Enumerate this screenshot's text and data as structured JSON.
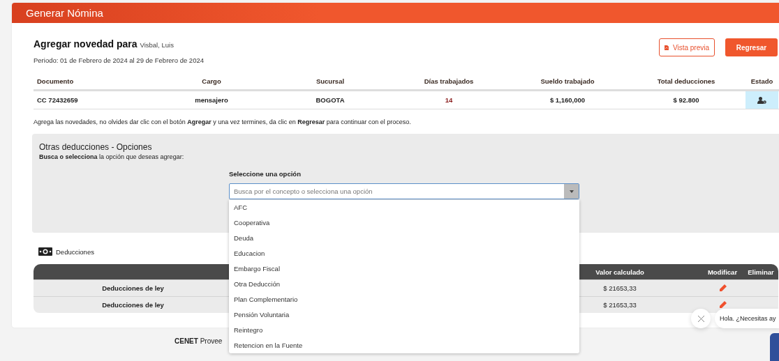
{
  "header": {
    "title": "Generar Nómina"
  },
  "heading": {
    "label": "Agregar novedad para",
    "name": "Visbal, Luis"
  },
  "period": "Periodo: 01 de Febrero de 2024 al 29 de Febrero de 2024",
  "actions": [
    {
      "label": "Vista previa",
      "kind": "outline"
    },
    {
      "label": "Regresar",
      "kind": "primary"
    }
  ],
  "employee_table": {
    "columns": [
      "Documento",
      "Cargo",
      "Sucursal",
      "Días trabajados",
      "Sueldo trabajado",
      "Total deducciones",
      "Estado"
    ],
    "rows": [
      {
        "cells": [
          "CC 72432659",
          "mensajero",
          "BOGOTA",
          "14",
          "$ 1,160,000",
          "$ 92.800"
        ]
      }
    ]
  },
  "instructions": "Agrega las novedades, no olvides dar clic con el botón **Agregar** y una vez termines, da clic en **Regresar** para continuar con el proceso.",
  "options_panel": {
    "title": "Otras deducciones - Opciones",
    "subtitle": "**Busca o selecciona** la opción que deseas agregar:",
    "field_label": "Seleccione una opción",
    "placeholder": "Busca por el concepto o selecciona una opción",
    "options": [
      "AFC",
      "Cooperativa",
      "Deuda",
      "Educacion",
      "Embargo Fiscal",
      "Otra Deducción",
      "Plan Complementario",
      "Pensión Voluntaria",
      "Reintegro",
      "Retencion en la Fuente"
    ]
  },
  "deductions": {
    "title": "Deducciones",
    "columns": [
      "Valor calculado",
      "Modificar",
      "Eliminar"
    ],
    "rows": [
      {
        "concept": "Deducciones de ley",
        "value": "$ 21653,33"
      },
      {
        "concept": "Deducciones de ley",
        "value": "$ 21653,33"
      }
    ]
  },
  "footer": "**CENET** Provee",
  "chat": {
    "message": "Hola. ¿Necesitas ay"
  }
}
